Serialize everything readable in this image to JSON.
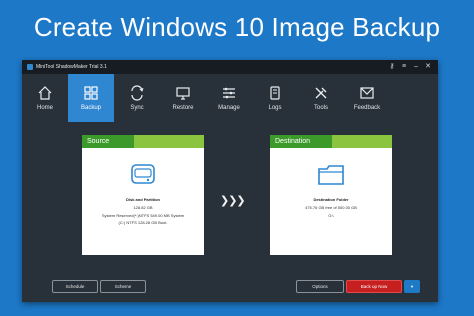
{
  "headline": "Create Windows 10 Image Backup",
  "window": {
    "title": "MiniTool ShadowMaker Trial 3.1"
  },
  "nav": {
    "items": [
      {
        "label": "Home"
      },
      {
        "label": "Backup"
      },
      {
        "label": "Sync"
      },
      {
        "label": "Restore"
      },
      {
        "label": "Manage"
      },
      {
        "label": "Logs"
      },
      {
        "label": "Tools"
      },
      {
        "label": "Feedback"
      }
    ],
    "active": "Backup"
  },
  "source": {
    "header": "Source",
    "title": "Disk and Partition",
    "size": "128.82 GB",
    "line1": "System Reserved(*:)NTFS 549.00 MB System",
    "line2": "(C:) NTFS 128.28 GB Boot."
  },
  "destination": {
    "header": "Destination",
    "title": "Destination Folder",
    "line1": "475.76 GB free of 500.00 GB",
    "line2": "G:\\"
  },
  "buttons": {
    "schedule": "Schedule",
    "scheme": "Scheme",
    "options": "Options",
    "backup_now": "Back up Now"
  },
  "colors": {
    "page_bg": "#1d78c8",
    "accent": "#2f86d1",
    "card_header": "#8bc540",
    "backup_button": "#c51f1f"
  },
  "icons": [
    "home-icon",
    "backup-icon",
    "sync-icon",
    "restore-icon",
    "manage-icon",
    "logs-icon",
    "tools-icon",
    "feedback-icon",
    "disk-icon",
    "folder-icon"
  ]
}
